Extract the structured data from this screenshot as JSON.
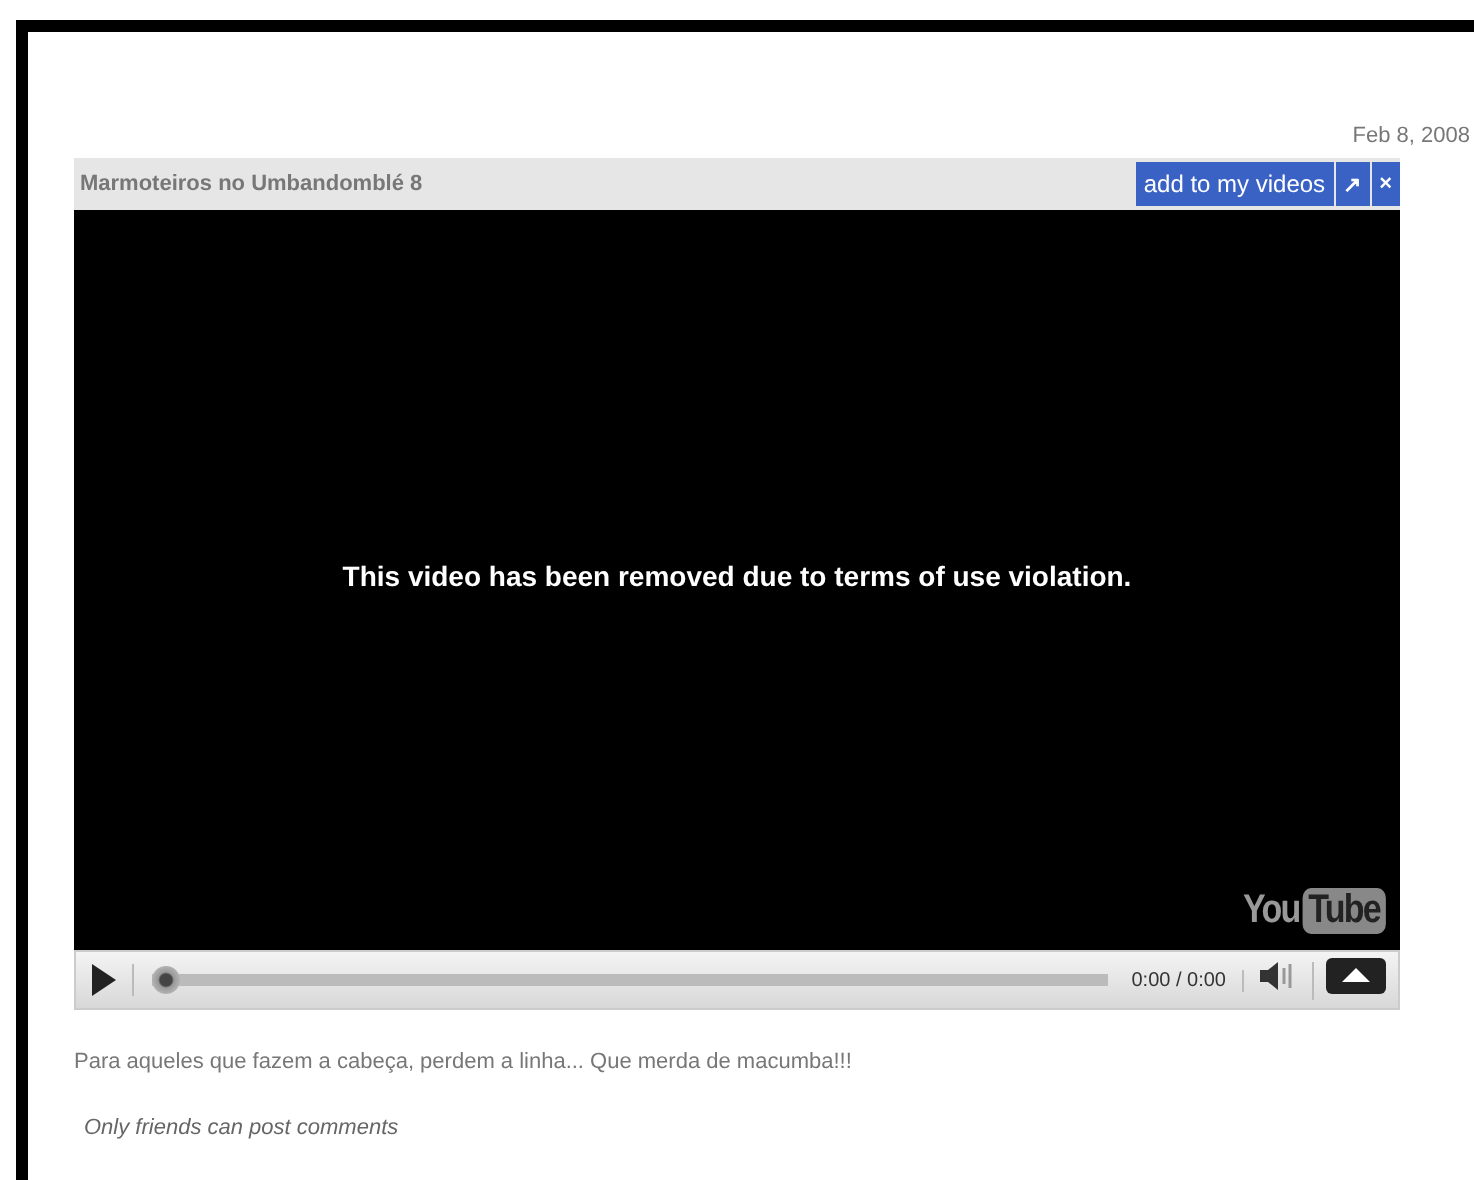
{
  "date": "Feb 8, 2008",
  "player": {
    "title": "Marmoteiros no Umbandomblé 8",
    "buttons": [
      {
        "kind": "add",
        "label": "add to my videos"
      },
      {
        "kind": "popout",
        "label": "↗"
      },
      {
        "kind": "close",
        "label": "×"
      }
    ],
    "message": "This video has been removed due to terms of use violation.",
    "logo": {
      "first": "You",
      "second": "Tube"
    },
    "controls": {
      "time": "0:00 / 0:00",
      "progress": {
        "level": 0
      }
    }
  },
  "description": "Para aqueles que fazem a cabeça, perdem a linha... Que merda de macumba!!!",
  "comments_note": "Only friends can post comments"
}
